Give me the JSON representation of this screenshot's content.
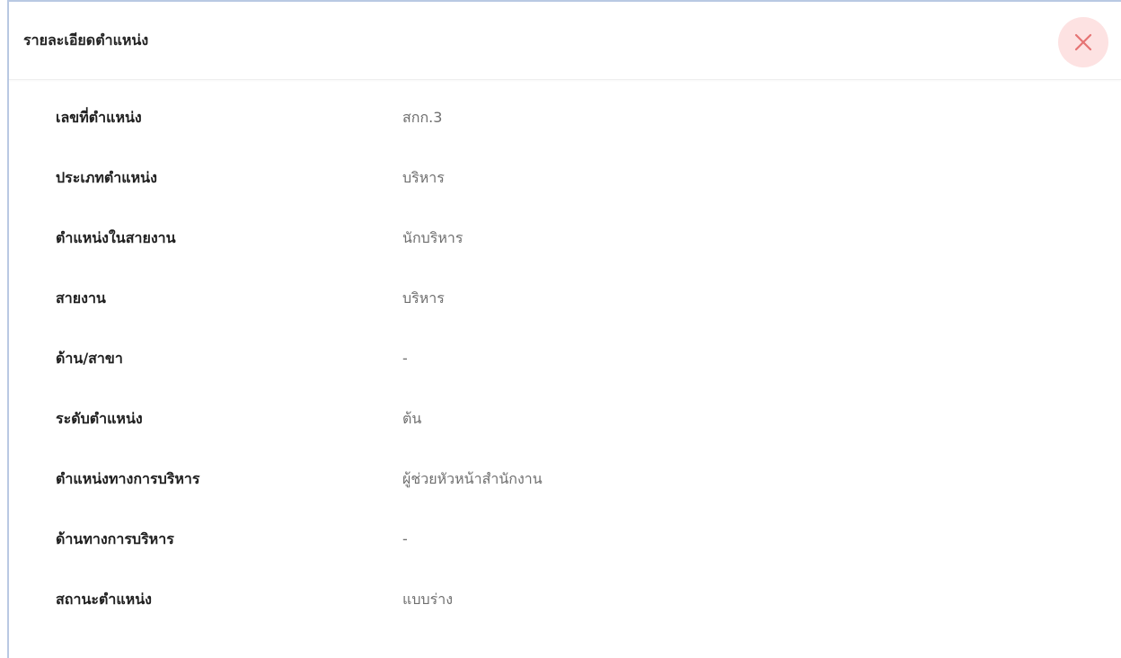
{
  "dialog": {
    "title": "รายละเอียดตำแหน่ง",
    "close_icon": "close-icon",
    "close_color": "#e57373",
    "close_bg": "#fde2e2"
  },
  "fields": [
    {
      "label": "เลขที่ตำแหน่ง",
      "value": "สกก.3"
    },
    {
      "label": "ประเภทตำแหน่ง",
      "value": "บริหาร"
    },
    {
      "label": "ตำแหน่งในสายงาน",
      "value": "นักบริหาร"
    },
    {
      "label": "สายงาน",
      "value": "บริหาร"
    },
    {
      "label": "ด้าน/สาขา",
      "value": "-"
    },
    {
      "label": "ระดับตำแหน่ง",
      "value": "ต้น"
    },
    {
      "label": "ตำแหน่งทางการบริหาร",
      "value": "ผู้ช่วยหัวหน้าสำนักงาน"
    },
    {
      "label": "ด้านทางการบริหาร",
      "value": "-"
    },
    {
      "label": "สถานะตำแหน่ง",
      "value": "แบบร่าง"
    }
  ]
}
